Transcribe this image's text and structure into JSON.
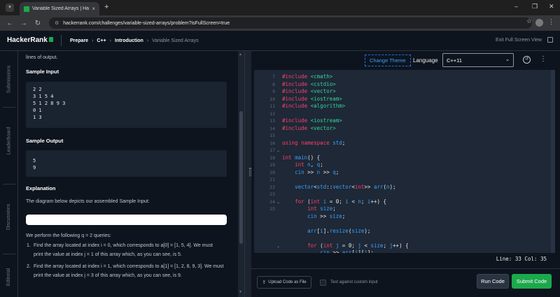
{
  "browser": {
    "tab_title": "Variable Sized Arrays | HackerRa",
    "url": "hackerrank.com/challenges/variable-sized-arrays/problem?isFullScreen=true"
  },
  "header": {
    "logo": "HackerRank",
    "breadcrumbs": [
      "Prepare",
      "C++",
      "Introduction",
      "Variable Sized Arrays"
    ],
    "exit_label": "Exit Full Screen View"
  },
  "side_rail": [
    "Submissions",
    "Leaderboard",
    "Discussions",
    "Editorial"
  ],
  "problem": {
    "output_note": "lines of output.",
    "sample_input_title": "Sample Input",
    "sample_input": [
      "2 2",
      "3 1 5 4",
      "5 1 2 8 9 3",
      "0 1",
      "1 3"
    ],
    "sample_output_title": "Sample Output",
    "sample_output": [
      "5",
      "9"
    ],
    "explanation_title": "Explanation",
    "explanation_intro": "The diagram below depicts our assembled Sample Input:",
    "queries_intro": "We perform the following q = 2 queries:",
    "steps": [
      {
        "num": "1.",
        "line1": "Find the array located at index i = 0, which corresponds to a[0] = [1, 5, 4]. We must",
        "line2": "print the value at index j = 1 of this array which, as you can see, is 5."
      },
      {
        "num": "2.",
        "line1": "Find the array located at index i = 1, which corresponds to a[1] = [1, 2, 8, 9, 3]. We must",
        "line2": "print the value at index j = 3 of this array which, as you can see, is 9."
      }
    ]
  },
  "toolbar": {
    "change_theme": "Change Theme",
    "language_label": "Language",
    "language_value": "C++11"
  },
  "editor": {
    "line_numbers": [
      "7",
      "8",
      "9",
      "10",
      "11",
      "12",
      "13",
      "14",
      "15",
      "16",
      "17",
      "18",
      "19",
      "20",
      "21",
      "22",
      "23",
      "24",
      "25"
    ],
    "status": "Line: 33  Col: 35"
  },
  "bottom": {
    "upload": "Upload Code as File",
    "custom_input": "Test against custom input",
    "run": "Run Code",
    "submit": "Submit Code"
  },
  "colors": {
    "accent": "#1ba94c",
    "link": "#39a0ff",
    "keyword": "#f6416c",
    "library": "#34d399"
  }
}
